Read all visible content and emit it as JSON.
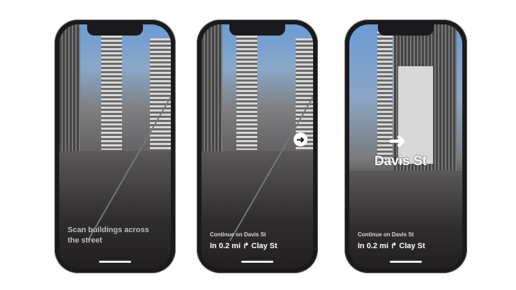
{
  "phones": [
    {
      "instruction": "Scan buildings across the street"
    },
    {
      "subtitle": "Continue on Davis St",
      "direction": "In 0.2 mi",
      "turn_icon": "turn-right-arrow",
      "street": "Clay St",
      "ar_marker": "right-arrow-circle"
    },
    {
      "ar_label": "Davis St",
      "ar_icon": "right-arrow",
      "subtitle": "Continue on Davis St",
      "direction": "In 0.2 mi",
      "turn_icon": "turn-right-arrow",
      "street": "Clay St"
    }
  ],
  "colors": {
    "sky": "#6c9bd4",
    "frame": "#1a1a1c"
  }
}
